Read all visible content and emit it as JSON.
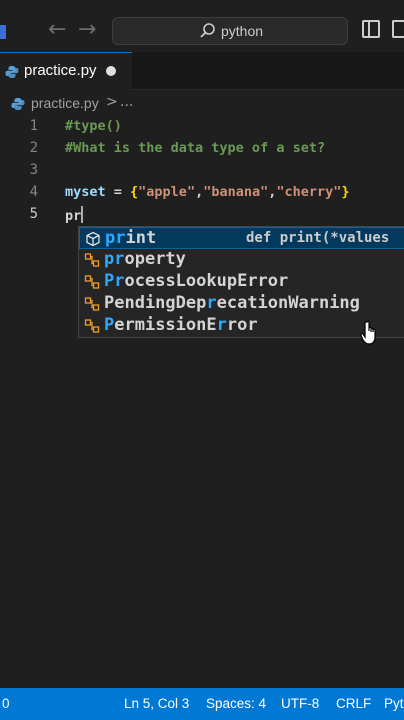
{
  "titlebar": {
    "search_text": "python"
  },
  "tab": {
    "label": "practice.py"
  },
  "breadcrumb": {
    "file": "practice.py",
    "separator": ">",
    "more": "..."
  },
  "editor": {
    "lines": [
      {
        "number": "1",
        "text": "#type()"
      },
      {
        "number": "2",
        "text": "#What is the data type of a set?"
      },
      {
        "number": "3",
        "text": ""
      },
      {
        "number": "4",
        "var": "myset",
        "op": " = ",
        "open": "{",
        "items": [
          "\"apple\"",
          ",",
          "\"banana\"",
          ",",
          "\"cherry\""
        ],
        "close": "}"
      },
      {
        "number": "5",
        "text": "pr"
      }
    ]
  },
  "suggest": {
    "items": [
      {
        "match": "pr",
        "rest": "int",
        "kind": "keyword",
        "detail": "def print(*values"
      },
      {
        "match": "pr",
        "rest": "operty",
        "kind": "class"
      },
      {
        "match": "P",
        "mid": "r",
        "rest": "ocessLookupError",
        "kind": "class"
      },
      {
        "pre": "PendingDep",
        "match": "r",
        "rest": "ecationWarning",
        "kind": "class"
      },
      {
        "match": "P",
        "mid": "ermissionE",
        "hl2": "r",
        "rest": "ror",
        "kind": "class"
      }
    ]
  },
  "statusbar": {
    "left": "0",
    "position": "Ln 5, Col 3",
    "spaces": "Spaces: 4",
    "encoding": "UTF-8",
    "eol": "CRLF",
    "language": "Pyt"
  },
  "colors": {
    "accent": "#0078d4",
    "background": "#1f1f1f",
    "comment": "#6a9955",
    "string": "#ce9178",
    "variable": "#9cdcfe",
    "brace": "#ffd700",
    "match_highlight": "#2aaaff"
  }
}
